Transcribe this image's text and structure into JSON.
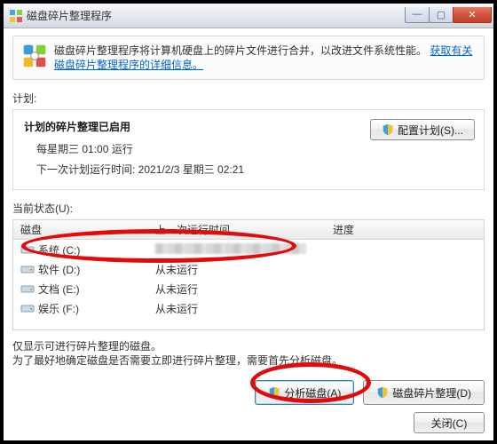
{
  "window": {
    "title": "磁盘碎片整理程序",
    "min_glyph": "—",
    "max_glyph": "▢",
    "close_glyph": "✕"
  },
  "info": {
    "text": "磁盘碎片整理程序将计算机硬盘上的碎片文件进行合并，以改进文件系统性能。",
    "link": "获取有关磁盘碎片整理程序的详细信息。"
  },
  "schedule": {
    "section_label_prefix": "计划",
    "section_label": ":",
    "title": "计划的碎片整理已启用",
    "freq": "每星期三 01:00 运行",
    "next_label": "下一次计划运行时间: ",
    "next_value": "2021/2/3 星期三 02:21",
    "config_btn": "配置计划(S)..."
  },
  "status": {
    "section_label": "当前状态(U):",
    "header": {
      "disk": "磁盘",
      "last": "上一次运行时间",
      "prog": "进度"
    },
    "drives": [
      {
        "name": "系统 (C:)",
        "last": "__blur__"
      },
      {
        "name": "软件 (D:)",
        "last": "从未运行"
      },
      {
        "name": "文档 (E:)",
        "last": "从未运行"
      },
      {
        "name": "娱乐 (F:)",
        "last": "从未运行"
      }
    ]
  },
  "footer": {
    "line1": "仅显示可进行碎片整理的磁盘。",
    "line2": "为了最好地确定磁盘是否需要立即进行碎片整理，需要首先分析磁盘。"
  },
  "buttons": {
    "analyze": "分析磁盘(A)",
    "defrag": "磁盘碎片整理(D)",
    "close": "关闭(C)"
  }
}
